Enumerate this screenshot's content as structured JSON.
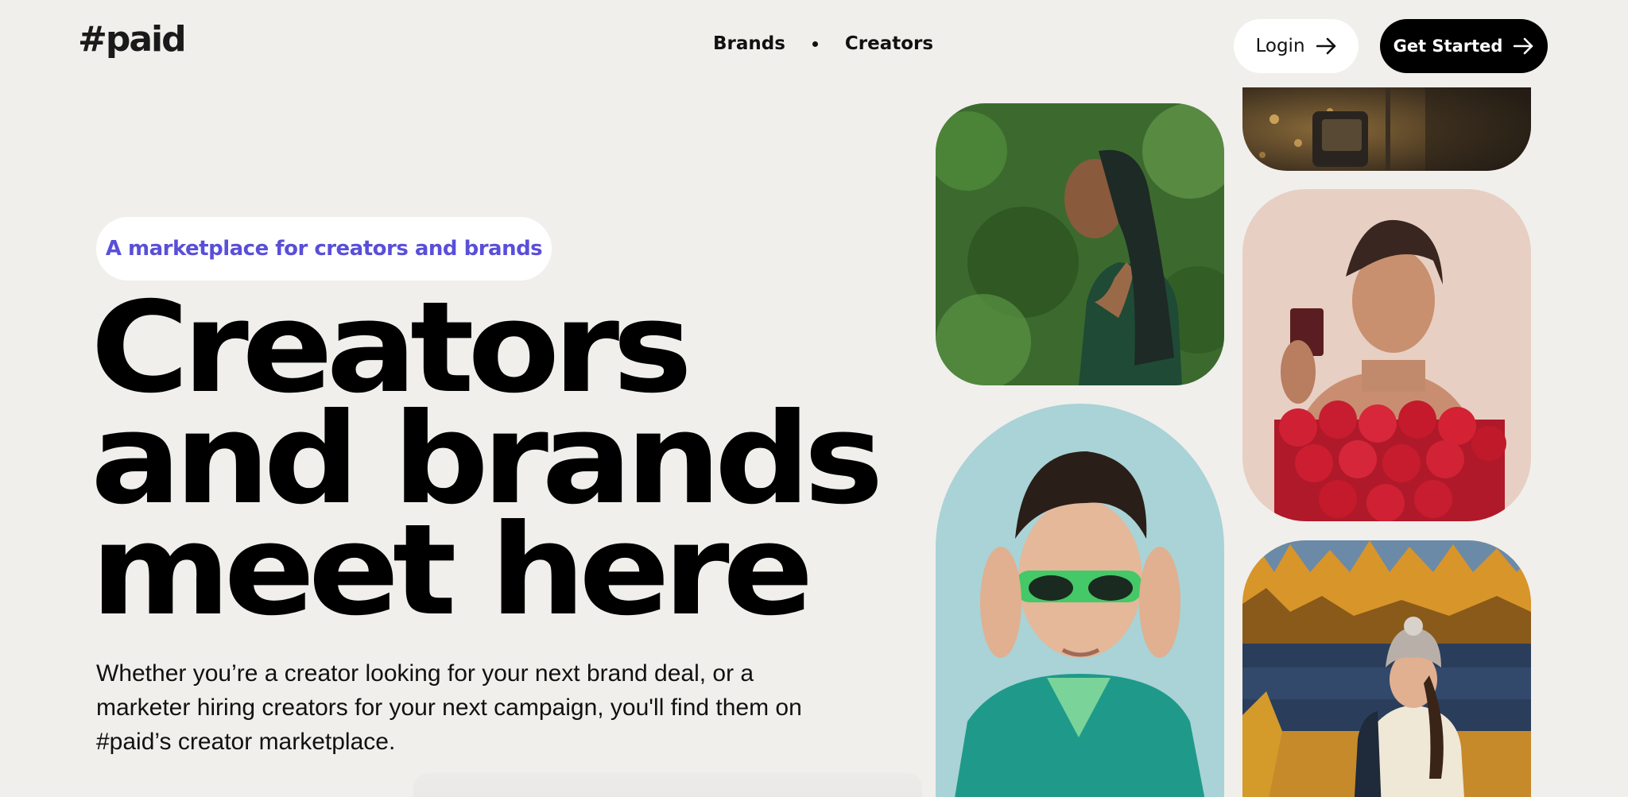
{
  "header": {
    "logo": "#paid",
    "nav": [
      {
        "label": "Brands"
      },
      {
        "label": "Creators"
      }
    ],
    "login_label": "Login",
    "get_started_label": "Get Started"
  },
  "hero": {
    "badge": "A marketplace for creators and brands",
    "headline_lines": [
      "Creators",
      "and brands",
      "meet here"
    ],
    "description": "Whether you’re a creator looking for your next brand deal, or a marketer hiring creators for your next campaign, you'll find them on #paid’s creator marketplace."
  },
  "colors": {
    "background": "#f0efec",
    "accent": "#5a4fd8",
    "button_dark": "#000000",
    "button_light": "#ffffff"
  },
  "photos": [
    {
      "subject": "hands holding perfume bottle with bokeh lights"
    },
    {
      "subject": "woman with long dark green hair in front of foliage"
    },
    {
      "subject": "woman holding perfume with red roses"
    },
    {
      "subject": "man adjusting green sunglasses in teal jacket"
    },
    {
      "subject": "woman hiker with beanie by autumn lake"
    }
  ]
}
